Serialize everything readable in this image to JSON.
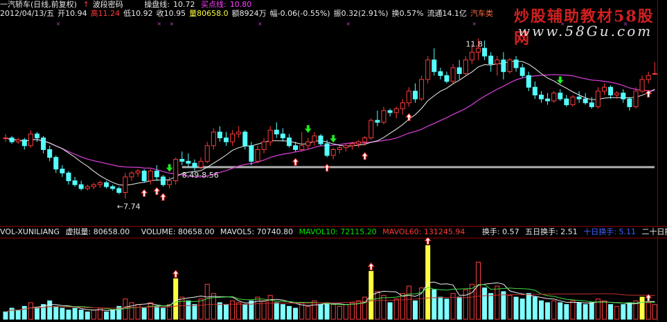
{
  "header": {
    "title": "一汽轿车(日线,前复权)",
    "indicator": "波段密码",
    "pivot_label": "操盘线:",
    "pivot_value": "10.72",
    "buy_label": "买点线:",
    "buy_value": "10.80",
    "date": "2012/04/13/五",
    "open": "开10.94",
    "high": "高11.24",
    "low": "低10.92",
    "close": "收10.95",
    "volume": "量80658.0",
    "amount": "额8924万",
    "change": "幅-0.06(-0.55%)",
    "amplitude": "振0.32(2.91%)",
    "turnover": "换0.57%",
    "float_cap": "流通14.1亿",
    "sector": "汽车类"
  },
  "watermark": {
    "title": "炒股辅助教材",
    "brand": "58股网",
    "url": "www.58Gu.com"
  },
  "annotations": {
    "high_label": "11.8",
    "low_label": "←7.74",
    "range_label": "8.49-8.56"
  },
  "volume_header": {
    "name": "VOL-XUNILIANG",
    "virtual": "虚拟量: 80658.00",
    "volume": "VOLUME: 80658.00",
    "mavol5": "MAVOL5: 70740.80",
    "mavol10": "MAVOL10: 72115.20",
    "mavol60": "MAVOL60: 131245.94",
    "turnover": "换手: 0.57",
    "turnover5": "五日换手: 2.51",
    "turnover10": "十日换手: 5.11",
    "turnover20": "二十日换"
  },
  "colors": {
    "up": "#ff3b3b",
    "down": "#54ffff",
    "ma_white": "#f0f0f0",
    "ma_magenta": "#d03cd0",
    "support": "#b0b0b0",
    "vol_up": "#ff4040",
    "vol_down": "#80ffff",
    "vol_special": "#ffff40"
  },
  "chart_data": {
    "type": "candlestick",
    "ylim": [
      7.2,
      12.2
    ],
    "support_level": 8.55,
    "candles": [
      [
        9.3,
        9.4,
        9.2,
        9.3
      ],
      [
        9.3,
        9.35,
        9.15,
        9.2
      ],
      [
        9.2,
        9.3,
        9.15,
        9.25
      ],
      [
        9.25,
        9.3,
        9.0,
        9.1
      ],
      [
        9.1,
        9.5,
        9.05,
        9.4
      ],
      [
        9.4,
        9.45,
        9.2,
        9.3
      ],
      [
        9.3,
        9.35,
        8.9,
        9.0
      ],
      [
        9.0,
        9.1,
        8.7,
        8.8
      ],
      [
        8.8,
        8.85,
        8.4,
        8.5
      ],
      [
        8.5,
        8.6,
        8.3,
        8.4
      ],
      [
        8.4,
        8.45,
        8.1,
        8.2
      ],
      [
        8.2,
        8.3,
        8.05,
        8.1
      ],
      [
        8.1,
        8.2,
        7.95,
        8.0
      ],
      [
        8.0,
        8.1,
        7.95,
        8.05
      ],
      [
        8.05,
        8.15,
        7.98,
        8.1
      ],
      [
        8.1,
        8.2,
        8.02,
        8.15
      ],
      [
        8.15,
        8.2,
        8.0,
        8.05
      ],
      [
        8.05,
        8.1,
        7.95,
        8.0
      ],
      [
        8.0,
        8.05,
        7.85,
        7.9
      ],
      [
        7.9,
        8.4,
        7.74,
        8.3
      ],
      [
        8.3,
        8.45,
        8.2,
        8.4
      ],
      [
        8.4,
        8.5,
        8.3,
        8.45
      ],
      [
        8.45,
        8.5,
        8.15,
        8.2
      ],
      [
        8.2,
        8.5,
        8.1,
        8.45
      ],
      [
        8.45,
        8.6,
        8.2,
        8.3
      ],
      [
        8.3,
        8.35,
        8.05,
        8.1
      ],
      [
        8.1,
        8.3,
        8.0,
        8.2
      ],
      [
        8.2,
        8.8,
        8.1,
        8.75
      ],
      [
        8.75,
        8.95,
        8.6,
        8.7
      ],
      [
        8.7,
        8.9,
        8.55,
        8.65
      ],
      [
        8.65,
        8.75,
        8.45,
        8.55
      ],
      [
        8.55,
        8.8,
        8.5,
        8.7
      ],
      [
        8.7,
        9.2,
        8.65,
        9.1
      ],
      [
        9.1,
        9.55,
        9.0,
        9.45
      ],
      [
        9.45,
        9.6,
        9.2,
        9.3
      ],
      [
        9.3,
        9.45,
        9.1,
        9.2
      ],
      [
        9.2,
        9.5,
        9.1,
        9.4
      ],
      [
        9.4,
        9.6,
        9.3,
        9.45
      ],
      [
        9.45,
        9.5,
        9.0,
        9.1
      ],
      [
        9.1,
        9.2,
        8.6,
        8.7
      ],
      [
        8.7,
        9.1,
        8.65,
        9.0
      ],
      [
        9.0,
        9.3,
        8.9,
        9.2
      ],
      [
        9.2,
        9.6,
        9.1,
        9.5
      ],
      [
        9.5,
        9.7,
        9.3,
        9.4
      ],
      [
        9.4,
        9.55,
        9.2,
        9.3
      ],
      [
        9.3,
        9.4,
        9.05,
        9.1
      ],
      [
        9.1,
        9.2,
        8.95,
        9.0
      ],
      [
        9.0,
        9.45,
        8.95,
        9.1
      ],
      [
        9.1,
        9.3,
        9.0,
        9.2
      ],
      [
        9.2,
        9.45,
        9.1,
        9.35
      ],
      [
        9.35,
        9.4,
        9.1,
        9.15
      ],
      [
        9.15,
        9.25,
        8.8,
        8.85
      ],
      [
        8.85,
        9.05,
        8.75,
        9.0
      ],
      [
        9.0,
        9.1,
        8.9,
        9.05
      ],
      [
        9.05,
        9.15,
        8.95,
        9.1
      ],
      [
        9.1,
        9.2,
        9.0,
        9.15
      ],
      [
        9.15,
        9.25,
        9.05,
        9.2
      ],
      [
        9.2,
        9.35,
        9.1,
        9.3
      ],
      [
        9.3,
        9.8,
        9.25,
        9.75
      ],
      [
        9.75,
        10.0,
        9.6,
        9.7
      ],
      [
        9.7,
        10.1,
        9.65,
        10.0
      ],
      [
        10.0,
        10.05,
        9.85,
        9.95
      ],
      [
        9.95,
        10.1,
        9.8,
        10.05
      ],
      [
        10.05,
        10.3,
        9.9,
        10.2
      ],
      [
        10.2,
        10.6,
        10.1,
        10.5
      ],
      [
        10.5,
        10.7,
        10.2,
        10.3
      ],
      [
        10.3,
        10.9,
        10.25,
        10.8
      ],
      [
        10.8,
        11.4,
        10.7,
        11.3
      ],
      [
        11.3,
        11.6,
        10.9,
        11.0
      ],
      [
        11.0,
        11.1,
        10.8,
        10.9
      ],
      [
        10.9,
        11.0,
        10.7,
        10.75
      ],
      [
        10.75,
        11.2,
        10.7,
        11.1
      ],
      [
        11.1,
        11.3,
        10.8,
        10.95
      ],
      [
        10.95,
        11.4,
        10.9,
        11.3
      ],
      [
        11.3,
        11.7,
        11.2,
        11.5
      ],
      [
        11.5,
        11.85,
        11.3,
        11.6
      ],
      [
        11.6,
        11.8,
        11.3,
        11.4
      ],
      [
        11.4,
        11.5,
        11.0,
        11.2
      ],
      [
        11.2,
        11.4,
        10.9,
        11.3
      ],
      [
        11.3,
        11.5,
        10.8,
        11.0
      ],
      [
        11.0,
        11.35,
        10.95,
        11.3
      ],
      [
        11.3,
        11.4,
        11.0,
        11.1
      ],
      [
        11.1,
        11.2,
        10.85,
        10.9
      ],
      [
        10.9,
        11.0,
        10.5,
        10.6
      ],
      [
        10.6,
        10.75,
        10.3,
        10.4
      ],
      [
        10.4,
        10.5,
        10.2,
        10.3
      ],
      [
        10.3,
        10.45,
        10.15,
        10.25
      ],
      [
        10.25,
        10.5,
        10.2,
        10.45
      ],
      [
        10.45,
        10.55,
        10.25,
        10.3
      ],
      [
        10.3,
        10.4,
        10.1,
        10.15
      ],
      [
        10.15,
        10.4,
        10.1,
        10.35
      ],
      [
        10.35,
        10.5,
        10.2,
        10.3
      ],
      [
        10.3,
        10.45,
        10.15,
        10.2
      ],
      [
        10.2,
        10.35,
        10.05,
        10.1
      ],
      [
        10.1,
        10.6,
        10.05,
        10.5
      ],
      [
        10.5,
        10.7,
        10.4,
        10.6
      ],
      [
        10.6,
        10.65,
        10.3,
        10.4
      ],
      [
        10.4,
        10.5,
        10.3,
        10.45
      ],
      [
        10.45,
        10.55,
        10.2,
        10.3
      ],
      [
        10.3,
        10.35,
        10.0,
        10.1
      ],
      [
        10.1,
        10.6,
        10.05,
        10.5
      ],
      [
        10.5,
        10.9,
        10.45,
        10.8
      ],
      [
        10.8,
        11.0,
        10.7,
        10.9
      ],
      [
        10.94,
        11.24,
        10.92,
        10.95
      ]
    ],
    "volume": [
      [
        4,
        0
      ],
      [
        6,
        0
      ],
      [
        5,
        0
      ],
      [
        7,
        0
      ],
      [
        9,
        1
      ],
      [
        6,
        0
      ],
      [
        8,
        0
      ],
      [
        10,
        0
      ],
      [
        7,
        0
      ],
      [
        6,
        0
      ],
      [
        5,
        0
      ],
      [
        6,
        0
      ],
      [
        5,
        0
      ],
      [
        4,
        0
      ],
      [
        5,
        1
      ],
      [
        6,
        1
      ],
      [
        4,
        0
      ],
      [
        5,
        0
      ],
      [
        7,
        0
      ],
      [
        11,
        1
      ],
      [
        9,
        1
      ],
      [
        8,
        1
      ],
      [
        6,
        0
      ],
      [
        9,
        1
      ],
      [
        7,
        0
      ],
      [
        6,
        0
      ],
      [
        8,
        1
      ],
      [
        22,
        2
      ],
      [
        12,
        1
      ],
      [
        10,
        0
      ],
      [
        8,
        0
      ],
      [
        11,
        1
      ],
      [
        19,
        1
      ],
      [
        14,
        1
      ],
      [
        9,
        0
      ],
      [
        8,
        0
      ],
      [
        10,
        1
      ],
      [
        9,
        1
      ],
      [
        8,
        0
      ],
      [
        10,
        0
      ],
      [
        12,
        1
      ],
      [
        10,
        1
      ],
      [
        13,
        1
      ],
      [
        9,
        0
      ],
      [
        8,
        0
      ],
      [
        7,
        0
      ],
      [
        6,
        0
      ],
      [
        9,
        1
      ],
      [
        7,
        1
      ],
      [
        10,
        1
      ],
      [
        8,
        0
      ],
      [
        9,
        0
      ],
      [
        8,
        1
      ],
      [
        7,
        1
      ],
      [
        8,
        1
      ],
      [
        9,
        1
      ],
      [
        10,
        1
      ],
      [
        12,
        1
      ],
      [
        26,
        2
      ],
      [
        15,
        1
      ],
      [
        13,
        1
      ],
      [
        9,
        0
      ],
      [
        11,
        1
      ],
      [
        14,
        1
      ],
      [
        18,
        1
      ],
      [
        10,
        0
      ],
      [
        17,
        1
      ],
      [
        40,
        2
      ],
      [
        16,
        0
      ],
      [
        12,
        0
      ],
      [
        11,
        0
      ],
      [
        14,
        1
      ],
      [
        12,
        0
      ],
      [
        16,
        1
      ],
      [
        19,
        1
      ],
      [
        31,
        1
      ],
      [
        17,
        0
      ],
      [
        14,
        0
      ],
      [
        18,
        1
      ],
      [
        15,
        0
      ],
      [
        13,
        1
      ],
      [
        12,
        0
      ],
      [
        11,
        0
      ],
      [
        14,
        0
      ],
      [
        12,
        0
      ],
      [
        10,
        0
      ],
      [
        9,
        0
      ],
      [
        10,
        1
      ],
      [
        9,
        0
      ],
      [
        8,
        0
      ],
      [
        10,
        1
      ],
      [
        9,
        0
      ],
      [
        8,
        0
      ],
      [
        9,
        0
      ],
      [
        11,
        1
      ],
      [
        10,
        1
      ],
      [
        8,
        0
      ],
      [
        7,
        1
      ],
      [
        8,
        0
      ],
      [
        9,
        0
      ],
      [
        10,
        1
      ],
      [
        12,
        2
      ],
      [
        9,
        1
      ],
      [
        8,
        1
      ]
    ],
    "vol_ylim": [
      0,
      42
    ],
    "arrows_up": [
      22,
      24,
      25,
      46,
      51,
      57,
      64,
      102
    ],
    "arrows_down": [
      26,
      48,
      52,
      88
    ],
    "vol_arrows": [
      27,
      58,
      67,
      102
    ]
  }
}
